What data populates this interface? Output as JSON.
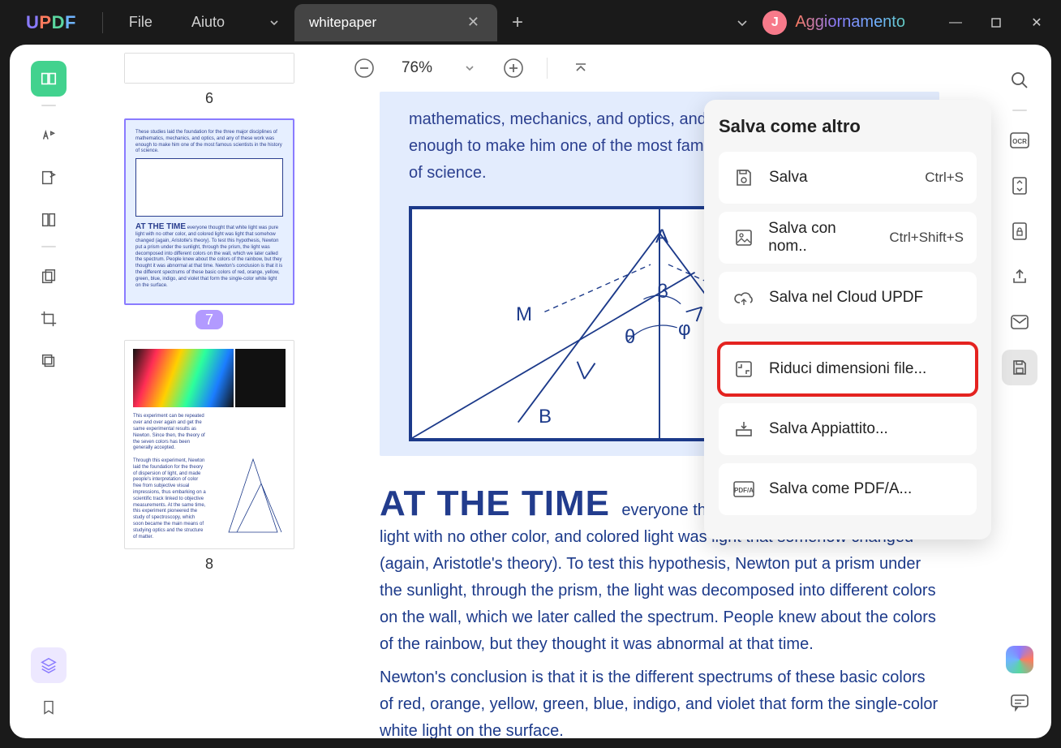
{
  "titlebar": {
    "logo": "UPDF",
    "menu_file": "File",
    "menu_help": "Aiuto",
    "tab_title": "whitepaper",
    "avatar_letter": "J",
    "update_label": "Aggiornamento"
  },
  "left_tools": [
    "reader",
    "highlight",
    "edit",
    "fields",
    "pages",
    "crop",
    "organize"
  ],
  "thumbs": {
    "p6": "6",
    "p7": "7",
    "p8": "8",
    "p7_heading": "AT THE TIME",
    "p7_text_top": "These studies laid the foundation for the three major disciplines of mathematics, mechanics, and optics, and any of these work was enough to make him one of the most famous scientists in the history of science.",
    "p7_text_body": "everyone thought that white light was pure light with no other color, and colored light was light that somehow changed (again, Aristotle's theory). To test this hypothesis, Newton put a prism under the sunlight, through the prism, the light was decomposed into different colors on the wall, which we later called the spectrum. People knew about the colors of the rainbow, but they thought it was abnormal at that time. Newton's conclusion is that it is the different spectrums of these basic colors of red, orange, yellow, green, blue, indigo, and violet that form the single-color white light on the surface."
  },
  "viewer": {
    "zoom": "76%",
    "para_top": "mathematics, mechanics, and optics, and any of these work was enough to make him one of the most famous scientists in the history of science.",
    "geo": {
      "A": "A",
      "B": "B",
      "M": "M",
      "beta": "β",
      "theta": "θ",
      "phi": "φ"
    },
    "heading": "AT THE TIME",
    "body1": "everyone thought that white light was pure light with no other color, and colored light was light that somehow changed (again, Aristotle's theory). To test this hypothesis, Newton put a prism under the sunlight, through the prism, the light was decomposed into different colors on the wall, which we later called the spectrum. People knew about the colors of the rainbow, but they thought it was abnormal at that time.",
    "body2": "Newton's conclusion is that it is the different spectrums of these basic colors of red, orange, yellow, green, blue, indigo, and violet that form the single-color white light on the surface."
  },
  "panel": {
    "title": "Salva come altro",
    "save": "Salva",
    "save_sc": "Ctrl+S",
    "save_as": "Salva con nom..",
    "save_as_sc": "Ctrl+Shift+S",
    "cloud": "Salva nel Cloud UPDF",
    "reduce": "Riduci dimensioni file...",
    "flatten": "Salva Appiattito...",
    "pdfa": "Salva come PDF/A..."
  }
}
